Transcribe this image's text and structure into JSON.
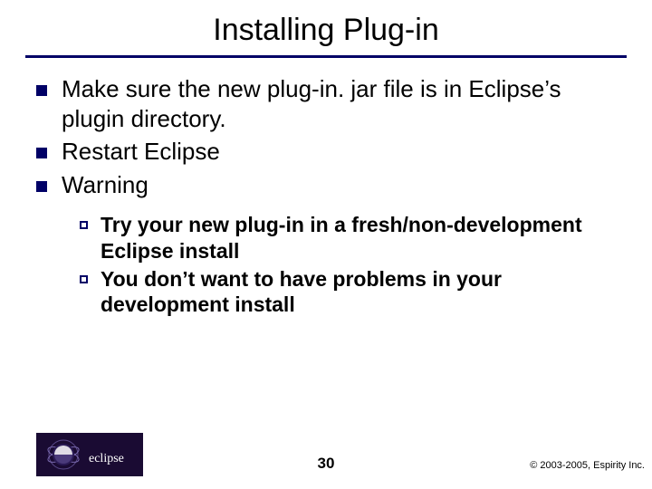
{
  "slide": {
    "title": "Installing Plug-in",
    "bullets": [
      {
        "text": "Make sure the new plug-in. jar file is in Eclipse’s plugin directory."
      },
      {
        "text": "Restart Eclipse"
      },
      {
        "text": "Warning"
      }
    ],
    "subbullets": [
      {
        "text": "Try your new plug-in in a fresh/non-development Eclipse install"
      },
      {
        "text": "You don’t want to have problems in your development install"
      }
    ],
    "page_number": "30",
    "copyright": "© 2003-2005, Espirity Inc.",
    "logo_alt": "eclipse"
  },
  "colors": {
    "accent": "#000066"
  }
}
